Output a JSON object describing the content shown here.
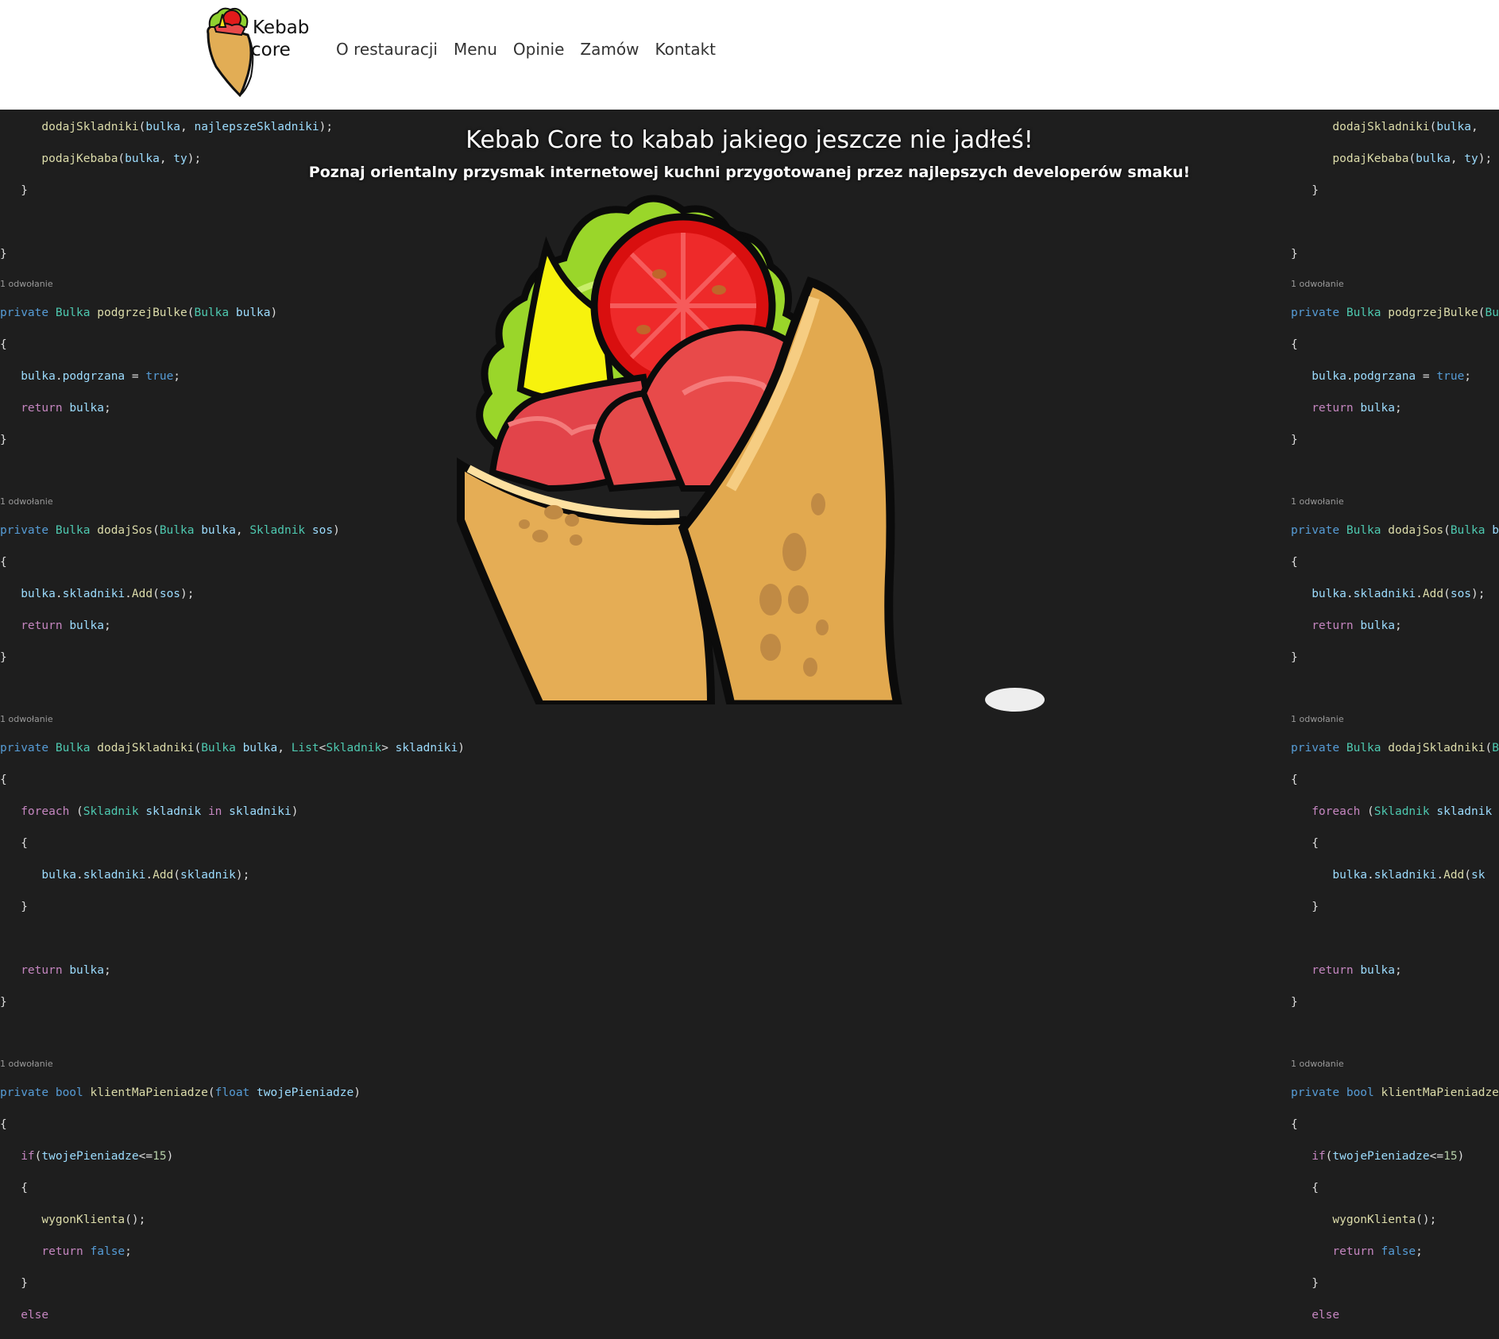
{
  "header": {
    "logo_text_line1": "Kebab",
    "logo_text_line2": "core",
    "nav": [
      {
        "label": "O restauracji"
      },
      {
        "label": "Menu"
      },
      {
        "label": "Opinie"
      },
      {
        "label": "Zamów"
      },
      {
        "label": "Kontakt"
      }
    ]
  },
  "hero": {
    "title": "Kebab Core to kabab jakiego jeszcze nie jadłeś!",
    "subtitle": "Poznaj orientalny przysmak internetowej kuchni przygotowanej przez najlepszych developerów smaku!"
  },
  "code": {
    "ref_label": "1 odwołanie"
  },
  "colors": {
    "background": "#1e1e1e",
    "header": "#ffffff",
    "keyword": "#569cd6",
    "type": "#4ec9b0",
    "method": "#dcdcaa",
    "variable": "#9cdcfe"
  }
}
